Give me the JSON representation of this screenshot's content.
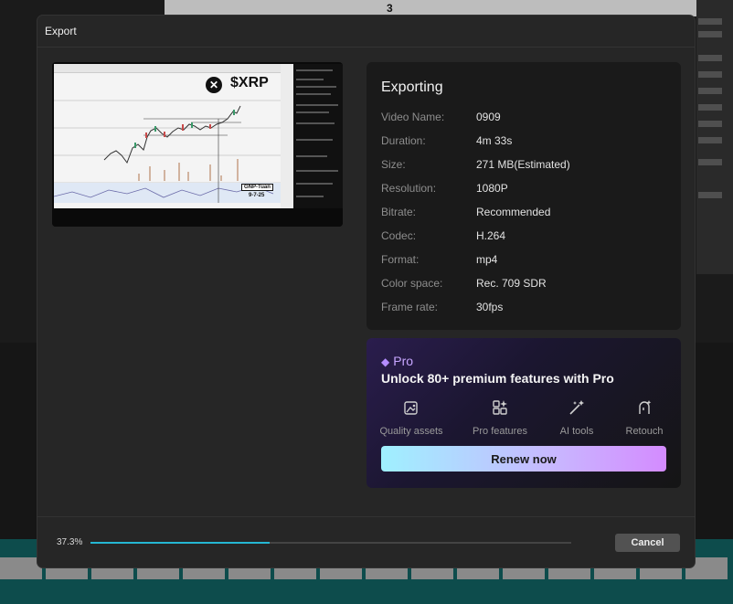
{
  "background": {
    "canvas_marker": "3"
  },
  "dialog": {
    "title": "Export"
  },
  "preview": {
    "symbol_icon": "xrp-logo-icon",
    "symbol": "$XRP",
    "tag": "GNP-Tuan",
    "tag_date": "9-7-25"
  },
  "info": {
    "title": "Exporting",
    "rows": [
      {
        "key": "Video Name:",
        "value": "0909"
      },
      {
        "key": "Duration:",
        "value": "4m 33s"
      },
      {
        "key": "Size:",
        "value": "271 MB(Estimated)"
      },
      {
        "key": "Resolution:",
        "value": "1080P"
      },
      {
        "key": "Bitrate:",
        "value": "Recommended"
      },
      {
        "key": "Codec:",
        "value": "H.264"
      },
      {
        "key": "Format:",
        "value": "mp4"
      },
      {
        "key": "Color space:",
        "value": "Rec. 709 SDR"
      },
      {
        "key": "Frame rate:",
        "value": "30fps"
      }
    ]
  },
  "pro": {
    "badge_icon": "diamond-icon",
    "badge": "Pro",
    "headline": "Unlock 80+ premium features with Pro",
    "features": [
      {
        "icon": "image-sparkle-icon",
        "label": "Quality assets"
      },
      {
        "icon": "grid-sparkle-icon",
        "label": "Pro features"
      },
      {
        "icon": "magic-wand-icon",
        "label": "AI tools"
      },
      {
        "icon": "face-retouch-icon",
        "label": "Retouch"
      }
    ],
    "cta": "Renew now",
    "colors": {
      "gradient_start": "#9ff0ff",
      "gradient_end": "#d48bff"
    }
  },
  "footer": {
    "progress_text": "37.3%",
    "progress_value": 0.373,
    "progress_color": "#25b7d3",
    "cancel": "Cancel"
  }
}
